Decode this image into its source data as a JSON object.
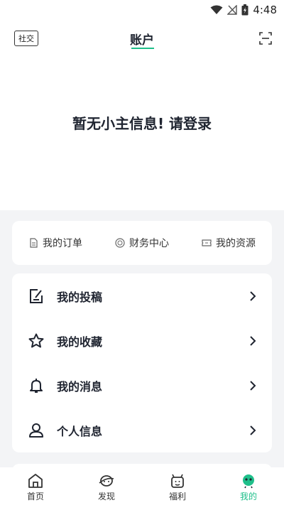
{
  "status": {
    "time": "4:48"
  },
  "header": {
    "social_label": "社交",
    "title": "账户"
  },
  "login_prompt": "暂无小主信息! 请登录",
  "quick_links": [
    {
      "label": "我的订单",
      "icon": "document-icon"
    },
    {
      "label": "财务中心",
      "icon": "coin-icon"
    },
    {
      "label": "我的资源",
      "icon": "ticket-icon"
    }
  ],
  "menu": [
    {
      "label": "我的投稿",
      "icon": "edit-note-icon"
    },
    {
      "label": "我的收藏",
      "icon": "star-icon"
    },
    {
      "label": "我的消息",
      "icon": "bell-icon"
    },
    {
      "label": "个人信息",
      "icon": "person-icon"
    }
  ],
  "tabs": [
    {
      "label": "首页",
      "icon": "home-icon",
      "active": false
    },
    {
      "label": "发现",
      "icon": "planet-icon",
      "active": false
    },
    {
      "label": "福利",
      "icon": "gift-face-icon",
      "active": false
    },
    {
      "label": "我的",
      "icon": "mine-face-icon",
      "active": true
    }
  ],
  "colors": {
    "accent": "#1fbf8a",
    "text": "#1f2430",
    "background": "#f3f4f6"
  }
}
